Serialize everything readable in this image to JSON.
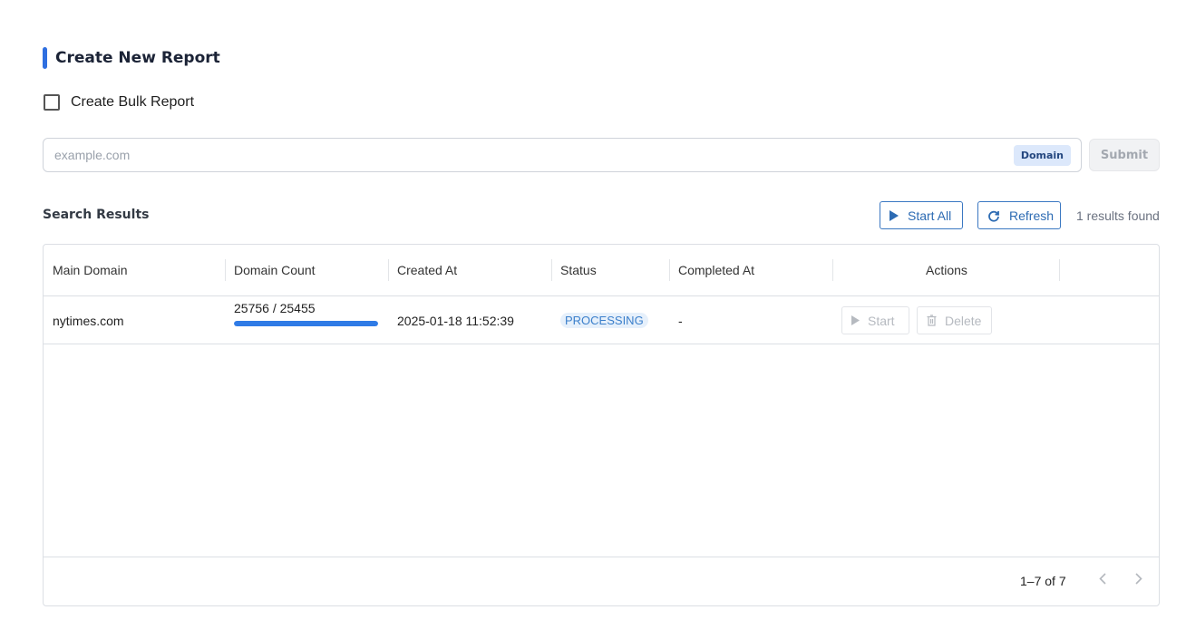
{
  "form": {
    "title": "Create New Report",
    "bulk_label": "Create Bulk Report",
    "bulk_checked": false,
    "domain_placeholder": "example.com",
    "domain_value": "",
    "domain_tag": "Domain",
    "submit_label": "Submit"
  },
  "results": {
    "title": "Search Results",
    "start_all_label": "Start All",
    "refresh_label": "Refresh",
    "count_text": "1 results found"
  },
  "table": {
    "columns": [
      "Main Domain",
      "Domain Count",
      "Created At",
      "Status",
      "Completed At",
      "Actions"
    ],
    "rows": [
      {
        "main_domain": "nytimes.com",
        "domain_count": "25756 / 25455",
        "progress_fraction": 1.0,
        "created_at": "2025-01-18 11:52:39",
        "status": "PROCESSING",
        "completed_at": "-",
        "start_label": "Start",
        "delete_label": "Delete"
      }
    ]
  },
  "pagination": {
    "range_text": "1–7 of 7"
  },
  "colors": {
    "accent": "#2f6fe0",
    "link": "#2d6bb3",
    "status_bg": "#e6f0fb",
    "status_text": "#3b7fcb"
  },
  "icons": {
    "start_all": "play-icon",
    "refresh": "refresh-icon",
    "start": "play-icon",
    "delete": "trash-icon",
    "prev": "chevron-left-icon",
    "next": "chevron-right-icon"
  }
}
